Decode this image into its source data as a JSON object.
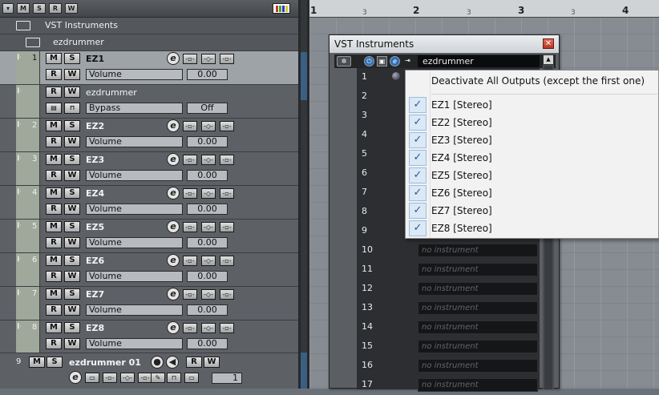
{
  "toolbar": {
    "buttons": [
      "▾",
      "M",
      "S",
      "R",
      "W"
    ]
  },
  "colors": {
    "accent": "#3a5f82",
    "menu_check": "#245b9c",
    "close": "#c0392b"
  },
  "folders": [
    {
      "label": "VST Instruments"
    },
    {
      "label": "ezdrummer"
    }
  ],
  "tracks": [
    {
      "num": "1",
      "name": "EZ1",
      "param": "Volume",
      "value": "0.00"
    },
    {
      "num": "",
      "name": "ezdrummer",
      "param": "Bypass",
      "value": "Off"
    },
    {
      "num": "2",
      "name": "EZ2",
      "param": "Volume",
      "value": "0.00"
    },
    {
      "num": "3",
      "name": "EZ3",
      "param": "Volume",
      "value": "0.00"
    },
    {
      "num": "4",
      "name": "EZ4",
      "param": "Volume",
      "value": "0.00"
    },
    {
      "num": "5",
      "name": "EZ5",
      "param": "Volume",
      "value": "0.00"
    },
    {
      "num": "6",
      "name": "EZ6",
      "param": "Volume",
      "value": "0.00"
    },
    {
      "num": "7",
      "name": "EZ7",
      "param": "Volume",
      "value": "0.00"
    },
    {
      "num": "8",
      "name": "EZ8",
      "param": "Volume",
      "value": "0.00"
    }
  ],
  "bottom_track": {
    "num": "9",
    "name": "ezdrummer 01",
    "counter": "1"
  },
  "ruler": {
    "bars": [
      "1",
      "2",
      "3",
      "4"
    ],
    "beats": [
      "3",
      "3",
      "3"
    ]
  },
  "vst_window": {
    "title": "VST Instruments",
    "plugin": "ezdrummer",
    "slots": [
      "1",
      "2",
      "3",
      "4",
      "5",
      "6",
      "7",
      "8",
      "9",
      "10",
      "11",
      "12",
      "13",
      "14",
      "15",
      "16",
      "17"
    ],
    "empty_label": "no instrument"
  },
  "context_menu": {
    "header": "Deactivate All Outputs (except the first one)",
    "items": [
      "EZ1 [Stereo]",
      "EZ2 [Stereo]",
      "EZ3 [Stereo]",
      "EZ4 [Stereo]",
      "EZ5 [Stereo]",
      "EZ6 [Stereo]",
      "EZ7 [Stereo]",
      "EZ8 [Stereo]"
    ],
    "check": "✓"
  },
  "labels": {
    "m": "M",
    "s": "S",
    "r": "R",
    "w": "W",
    "e": "e"
  }
}
